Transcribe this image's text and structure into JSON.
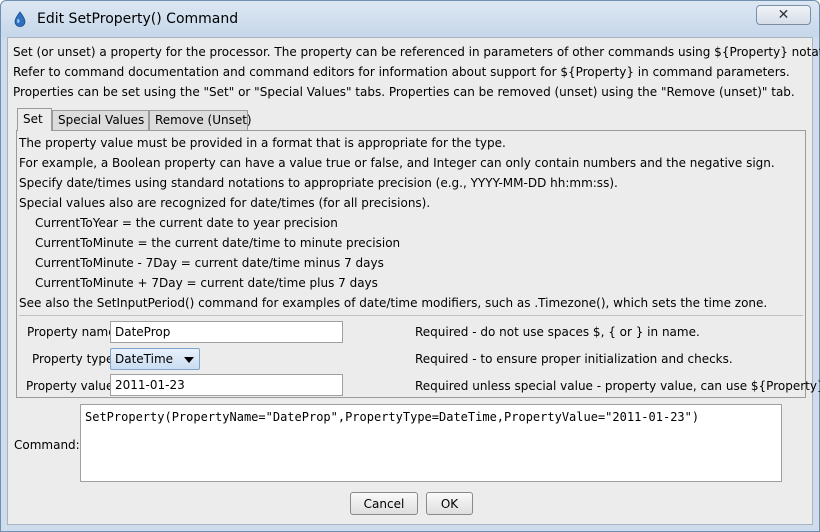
{
  "window": {
    "title": "Edit SetProperty() Command",
    "close_label": "✕"
  },
  "intro": [
    "Set (or unset) a property for the processor.  The property can be referenced in parameters of other commands using ${Property} notation.",
    "Refer to command documentation and command editors for information about support for ${Property} in command parameters.",
    "Properties can be set using the \"Set\" or \"Special Values\" tabs.  Properties can be removed (unset) using the \"Remove (unset)\" tab."
  ],
  "tabs": [
    {
      "label": "Set",
      "active": true
    },
    {
      "label": "Special Values",
      "active": false
    },
    {
      "label": "Remove (Unset)",
      "active": false
    }
  ],
  "set_tab": {
    "lines": [
      "The property value must be provided in a format that is appropriate for the type.",
      "For example, a Boolean property can have a value true or false, and Integer can only contain numbers and the negative sign.",
      "Specify date/times using standard notations to appropriate precision (e.g., YYYY-MM-DD hh:mm:ss).",
      "Special values also are recognized for date/times (for all precisions).",
      "CurrentToYear = the current date to year precision",
      "CurrentToMinute = the current date/time to minute precision",
      "CurrentToMinute - 7Day = current date/time minus 7 days",
      "CurrentToMinute + 7Day = current date/time plus 7 days",
      "See also the SetInputPeriod() command for examples of date/time modifiers, such as .Timezone(), which sets the time zone."
    ],
    "property_name": {
      "label": "Property name:",
      "value": "DateProp",
      "hint": "Required - do not use spaces $, { or } in name."
    },
    "property_type": {
      "label": "Property type:",
      "value": "DateTime",
      "hint": "Required - to ensure proper initialization and checks."
    },
    "property_value": {
      "label": "Property value:",
      "value": "2011-01-23",
      "hint": "Required unless special value - property value, can use ${Property}."
    }
  },
  "command": {
    "label": "Command:",
    "text": "SetProperty(PropertyName=\"DateProp\",PropertyType=DateTime,PropertyValue=\"2011-01-23\")"
  },
  "buttons": {
    "cancel": "Cancel",
    "ok": "OK"
  },
  "colors": {
    "title_bar": "#c6d7ea",
    "client_bg": "#ececec",
    "select_bg": "#c9ddf2"
  }
}
